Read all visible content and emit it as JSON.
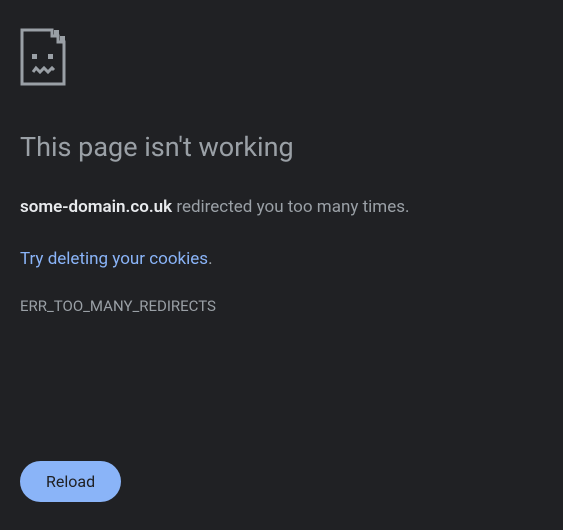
{
  "heading": "This page isn't working",
  "domain": "some-domain.co.uk",
  "message_suffix": " redirected you too many times.",
  "suggestion_link": "Try deleting your cookies",
  "suggestion_period": ".",
  "error_code": "ERR_TOO_MANY_REDIRECTS",
  "reload_label": "Reload"
}
